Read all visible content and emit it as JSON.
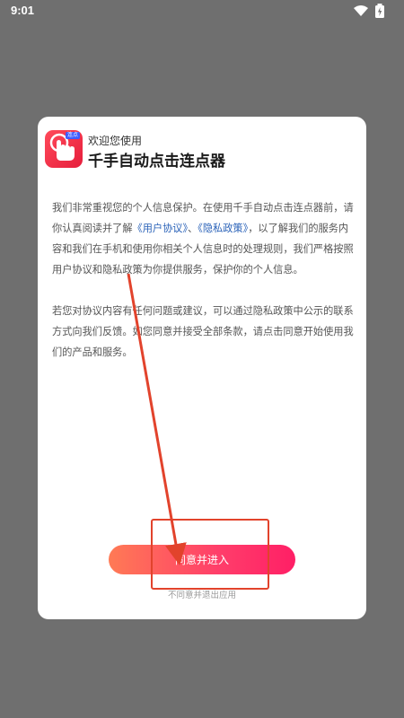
{
  "status_bar": {
    "time": "9:01",
    "icons": [
      "wifi-icon",
      "battery-icon"
    ]
  },
  "dialog": {
    "app_icon": "tap-finger-icon",
    "app_badge": "连点",
    "welcome": "欢迎您使用",
    "app_title": "千手自动点击连点器",
    "paragraph1": {
      "before_links": "我们非常重视您的个人信息保护。在使用千手自动点击连点器前，请你认真阅读并了解",
      "user_agreement": "《用户协议》",
      "separator": "、",
      "privacy_policy": "《隐私政策》",
      "after_links": "，以了解我们的服务内容和我们在手机和使用你相关个人信息时的处理规则，我们严格按照用户协议和隐私政策为你提供服务，保护你的个人信息。"
    },
    "paragraph2": "若您对协议内容有任何问题或建议，可以通过隐私政策中公示的联系方式向我们反馈。如您同意并接受全部条款，请点击同意开始使用我们的产品和服务。",
    "agree_button": "同意并进入",
    "decline_link": "不同意并退出应用"
  },
  "colors": {
    "overlay": "#6f6f6f",
    "link": "#2a62b8",
    "button_gradient_start": "#ff7a55",
    "button_gradient_end": "#ff1f66",
    "annotation": "#e2432c"
  }
}
